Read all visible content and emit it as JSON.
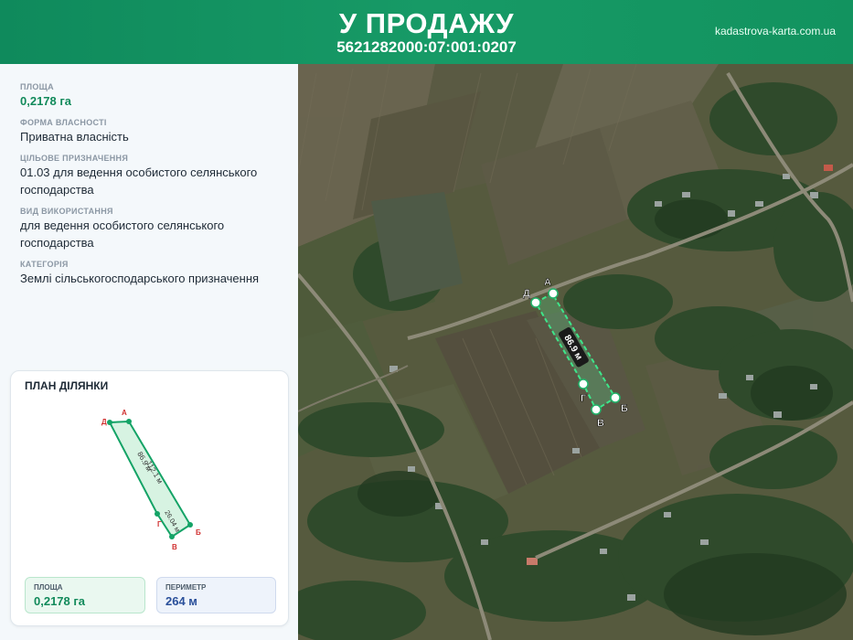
{
  "header": {
    "title": "У ПРОДАЖУ",
    "cadastral_number": "5621282000:07:001:0207",
    "site": "kadastrova-karta.com.ua"
  },
  "info": {
    "area_label": "ПЛОЩА",
    "area_value": "0,2178 га",
    "ownership_label": "ФОРМА ВЛАСНОСТІ",
    "ownership_value": "Приватна власність",
    "purpose_label": "ЦІЛЬОВЕ ПРИЗНАЧЕННЯ",
    "purpose_value": "01.03 для ведення особистого селянського господарства",
    "usage_label": "ВИД ВИКОРИСТАННЯ",
    "usage_value": "для ведення особистого селянського господарства",
    "category_label": "КАТЕГОРІЯ",
    "category_value": "Землі сільськогосподарського призначення"
  },
  "plan": {
    "title": "ПЛАН ДІЛЯНКИ",
    "vertices": [
      "А",
      "Б",
      "В",
      "Г",
      "Д"
    ],
    "side_long_1": "112.1 м",
    "side_long_2": "86.9 м",
    "side_short": "26.04 м",
    "area_label": "ПЛОЩА",
    "area_value": "0,2178 га",
    "perimeter_label": "ПЕРИМЕТР",
    "perimeter_value": "264 м"
  },
  "map": {
    "vertices": [
      "А",
      "Б",
      "В",
      "Г",
      "Д"
    ],
    "side_label": "86.9 м"
  },
  "colors": {
    "brand": "#12935f",
    "parcel": "#2fd07a",
    "vertex_label": "#d03030"
  }
}
